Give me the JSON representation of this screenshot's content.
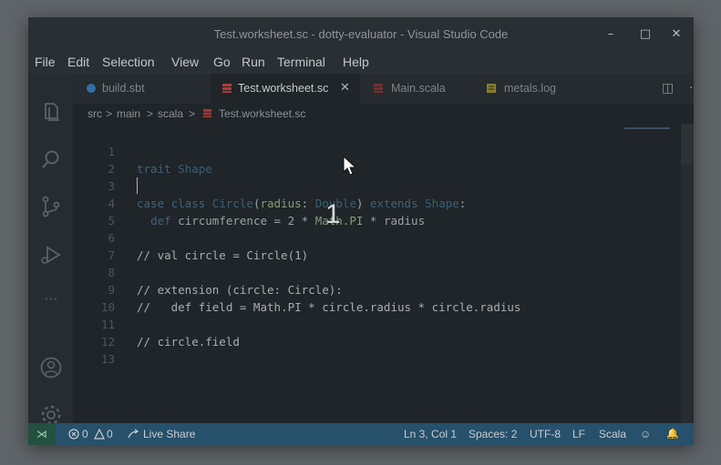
{
  "window": {
    "title": "Test.worksheet.sc - dotty-evaluator - Visual Studio Code",
    "minimize_glyph": "–",
    "maximize_glyph": "□",
    "close_glyph": "✕"
  },
  "menu": [
    "File",
    "Edit",
    "Selection",
    "View",
    "Go",
    "Run",
    "Terminal",
    "Help"
  ],
  "activity_bar": [
    "explorer-icon",
    "search-icon",
    "source-control-icon",
    "run-debug-icon",
    "more-icon",
    "account-icon",
    "settings-gear-icon"
  ],
  "activity_more_glyph": "···",
  "tabs": [
    {
      "label": "build.sbt",
      "icon": "sbt-file-icon",
      "active": false
    },
    {
      "label": "Test.worksheet.sc",
      "icon": "scala-file-icon",
      "active": true,
      "close": "✕"
    },
    {
      "label": "Main.scala",
      "icon": "scala-file-icon",
      "active": false
    },
    {
      "label": "metals.log",
      "icon": "log-file-icon",
      "active": false
    }
  ],
  "tab_actions": {
    "split": "◫",
    "more": "···"
  },
  "breadcrumb": {
    "parts": [
      "src",
      "main",
      "scala",
      "Test.worksheet.sc"
    ],
    "separator": ">"
  },
  "editor": {
    "line_numbers": [
      "1",
      "2",
      "3",
      "4",
      "5",
      "6",
      "7",
      "8",
      "9",
      "10",
      "11",
      "12",
      "13"
    ],
    "lines": {
      "l2_kw": "trait",
      "l2_ty": "Shape",
      "l4_kw1": "case class",
      "l4_ty1": "Circle",
      "l4_p1": "(",
      "l4_id": "radius",
      "l4_p2": ": ",
      "l4_ty2": "Double",
      "l4_p3": ") ",
      "l4_kw2": "extends",
      "l4_ty3": "Shape",
      "l4_p4": ":",
      "l5_kw": "def",
      "l5_p1": " circumference = 2 * ",
      "l5_id": "Math.PI",
      "l5_p2": " * radius",
      "l7": "// val circle = Circle(1)",
      "l9": "// extension (circle: Circle):",
      "l10": "//   def field = Math.PI * circle.radius * circle.radius",
      "l12": "// circle.field"
    }
  },
  "overlay_number": "1",
  "status": {
    "remote_glyph": "⋊",
    "errors": "0",
    "warnings": "0",
    "live_share": "Live Share",
    "cursor": "Ln 3, Col 1",
    "spaces": "Spaces: 2",
    "encoding": "UTF-8",
    "eol": "LF",
    "language": "Scala",
    "feedback_glyph": "☺",
    "bell_glyph": "🔔"
  },
  "colors": {
    "accent": "#27506b",
    "editor_bg": "#1f2528",
    "remote_bg": "#245040"
  }
}
